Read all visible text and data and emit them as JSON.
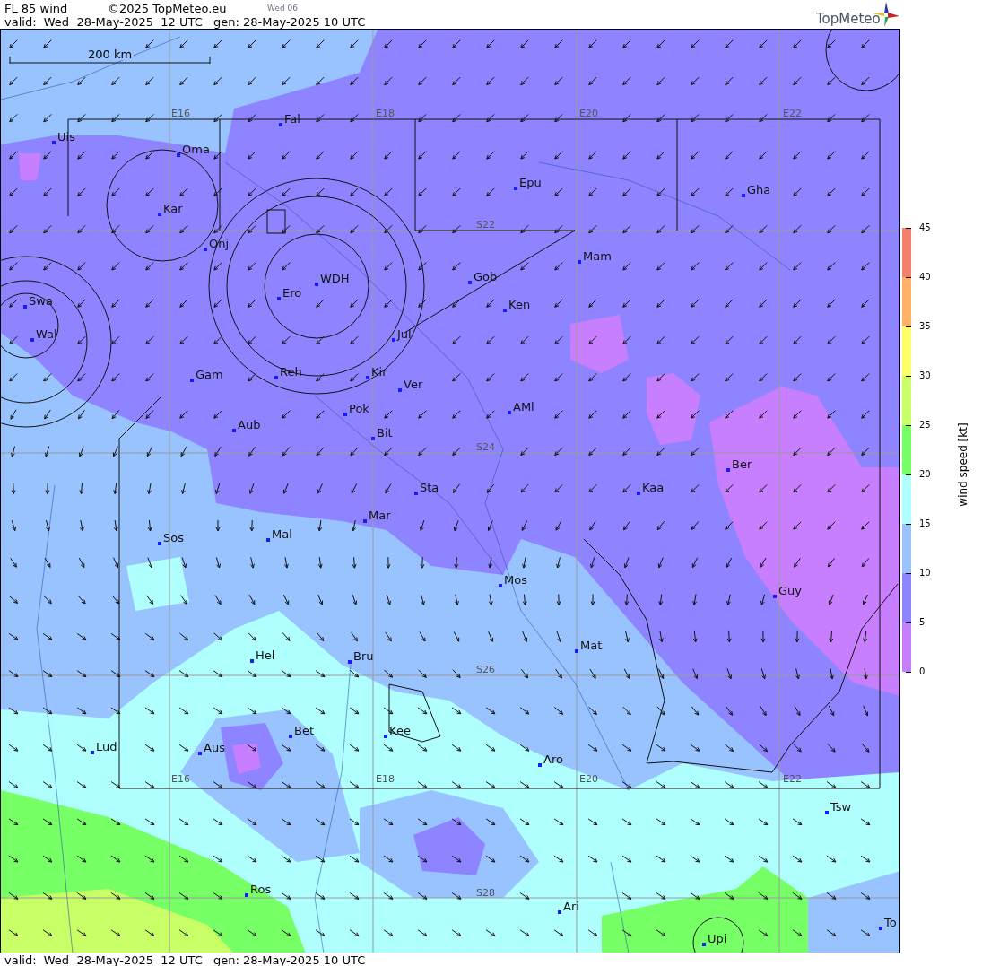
{
  "header": {
    "title": "FL 85 wind",
    "copyright": "©2025 TopMeteo.eu",
    "day": "Wed 06",
    "valid": "valid:  Wed  28-May-2025  12 UTC",
    "gen": "gen: 28-May-2025 10 UTC",
    "logo": "TopMeteo"
  },
  "map": {
    "scale": "200 km",
    "grid_labels": [
      "E16",
      "E18",
      "E20",
      "E22",
      "S22",
      "S24",
      "S26",
      "S28",
      "E16",
      "E18",
      "E20",
      "E22"
    ],
    "places": [
      "Uis",
      "Oma",
      "Fal",
      "Kar",
      "Onj",
      "Epu",
      "Gha",
      "Mam",
      "Gob",
      "Ken",
      "WDH",
      "Ero",
      "Swa",
      "Wal",
      "Jul",
      "Gam",
      "Reh",
      "Kir",
      "Ver",
      "AMl",
      "Pok",
      "Bit",
      "Aub",
      "Ber",
      "Sta",
      "Kaa",
      "Mar",
      "Sos",
      "Mal",
      "Mos",
      "Guy",
      "Hel",
      "Bru",
      "Mat",
      "Bet",
      "Kee",
      "Lud",
      "Aus",
      "Aro",
      "Tsw",
      "Ros",
      "Ari",
      "Upi",
      "To"
    ]
  },
  "legend": {
    "title": "wind speed [kt]",
    "ticks": [
      "45",
      "40",
      "35",
      "30",
      "25",
      "20",
      "15",
      "10",
      "5",
      "0"
    ],
    "bands": [
      {
        "color": "#f47f6a"
      },
      {
        "color": "#ffb266"
      },
      {
        "color": "#ffff66"
      },
      {
        "color": "#c8ff66"
      },
      {
        "color": "#77ff66"
      },
      {
        "color": "#b0ffff"
      },
      {
        "color": "#99c3ff"
      },
      {
        "color": "#8f84ff"
      },
      {
        "color": "#c77fff"
      }
    ]
  },
  "footer": {
    "valid": "valid:  Wed  28-May-2025  12 UTC",
    "gen": "gen: 28-May-2025 10 UTC"
  }
}
